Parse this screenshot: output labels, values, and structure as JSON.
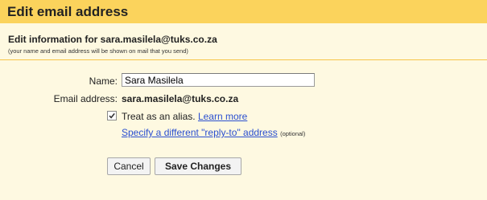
{
  "dialog": {
    "title": "Edit email address",
    "subtitle": "Edit information for sara.masilela@tuks.co.za",
    "note": "(your name and email address will be shown on mail that you send)"
  },
  "form": {
    "name_label": "Name:",
    "name_value": "Sara Masilela",
    "email_label": "Email address:",
    "email_value": "sara.masilela@tuks.co.za",
    "alias_checked": true,
    "alias_text": "Treat as an alias.",
    "learn_more": "Learn more",
    "reply_to_link": "Specify a different \"reply-to\" address",
    "optional_note": "(optional)"
  },
  "buttons": {
    "cancel": "Cancel",
    "save": "Save Changes"
  },
  "colors": {
    "titlebar": "#fbd35c",
    "background": "#fef9e1",
    "link": "#2a4fd0"
  }
}
